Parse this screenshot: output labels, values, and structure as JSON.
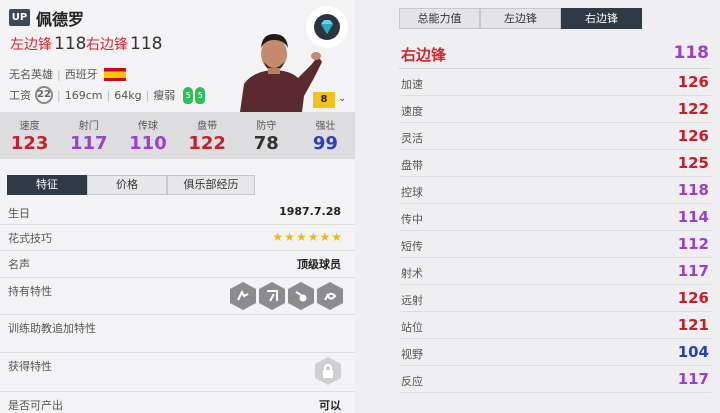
{
  "player": {
    "badge": "UP",
    "name": "佩德罗",
    "positions": [
      {
        "label": "左边锋",
        "value": "118"
      },
      {
        "label": "右边锋",
        "value": "118"
      }
    ],
    "team": "无名英雄",
    "nation": "西班牙",
    "salary_label": "工资",
    "salary": "22",
    "height": "169cm",
    "weight": "64kg",
    "body": "瘦弱",
    "left_foot": "5",
    "right_foot": "5",
    "level": "8"
  },
  "stats": [
    {
      "label": "速度",
      "value": "123",
      "color": "#c4202a"
    },
    {
      "label": "射门",
      "value": "117",
      "color": "#9b3fd0"
    },
    {
      "label": "传球",
      "value": "110",
      "color": "#9b3fd0"
    },
    {
      "label": "盘带",
      "value": "122",
      "color": "#c4202a"
    },
    {
      "label": "防守",
      "value": "78",
      "color": "#333333"
    },
    {
      "label": "强壮",
      "value": "99",
      "color": "#2a40b8"
    }
  ],
  "left_tabs": [
    "特征",
    "价格",
    "俱乐部经历"
  ],
  "info": {
    "birthday_label": "生日",
    "birthday": "1987.7.28",
    "skill_label": "花式技巧",
    "skill_stars": 6,
    "fame_label": "名声",
    "fame": "顶级球员",
    "traits_label": "持有特性",
    "trainer_label": "训练助教追加特性",
    "acquired_label": "获得特性",
    "tradable_label": "是否可产出",
    "tradable": "可以"
  },
  "right_tabs": [
    "总能力值",
    "左边锋",
    "右边锋"
  ],
  "detail": {
    "position": "右边锋",
    "overall": "118",
    "rows": [
      {
        "label": "加速",
        "value": "126",
        "color": "#c4202a"
      },
      {
        "label": "速度",
        "value": "122",
        "color": "#c4202a"
      },
      {
        "label": "灵活",
        "value": "126",
        "color": "#c4202a"
      },
      {
        "label": "盘带",
        "value": "125",
        "color": "#c4202a"
      },
      {
        "label": "控球",
        "value": "118",
        "color": "#9b3fd0"
      },
      {
        "label": "传中",
        "value": "114",
        "color": "#9b3fd0"
      },
      {
        "label": "短传",
        "value": "112",
        "color": "#9b3fd0"
      },
      {
        "label": "射术",
        "value": "117",
        "color": "#9b3fd0"
      },
      {
        "label": "远射",
        "value": "126",
        "color": "#c4202a"
      },
      {
        "label": "站位",
        "value": "121",
        "color": "#c4202a"
      },
      {
        "label": "视野",
        "value": "104",
        "color": "#2a40b8"
      },
      {
        "label": "反应",
        "value": "117",
        "color": "#9b3fd0"
      }
    ]
  },
  "icons": {
    "season": "diamond-icon",
    "traits": [
      "trait-1-icon",
      "trait-2-icon",
      "trait-3-icon",
      "trait-4-icon"
    ],
    "acquired": "lock-icon"
  }
}
